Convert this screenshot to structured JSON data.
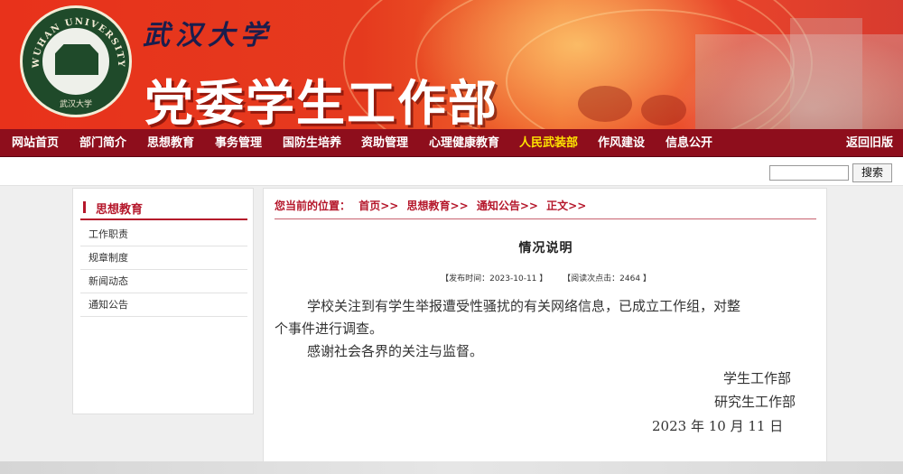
{
  "header": {
    "calligraphy": "武汉大学",
    "title": "党委学生工作部",
    "logo_ring_text": "WUHAN UNIVERSITY",
    "logo_sub_text": "武汉大学"
  },
  "nav": {
    "items": [
      {
        "label": "网站首页"
      },
      {
        "label": "部门简介"
      },
      {
        "label": "思想教育"
      },
      {
        "label": "事务管理"
      },
      {
        "label": "国防生培养"
      },
      {
        "label": "资助管理"
      },
      {
        "label": "心理健康教育"
      },
      {
        "label": "人民武装部",
        "active": true
      },
      {
        "label": "作风建设"
      },
      {
        "label": "信息公开"
      }
    ],
    "back_label": "返回旧版"
  },
  "search": {
    "value": "",
    "button_label": "搜索"
  },
  "sidebar": {
    "heading": "思想教育",
    "items": [
      {
        "label": "工作职责"
      },
      {
        "label": "规章制度"
      },
      {
        "label": "新闻动态"
      },
      {
        "label": "通知公告"
      }
    ]
  },
  "breadcrumb": {
    "prefix": "您当前的位置：",
    "items": [
      "首页>>",
      "思想教育>>",
      "通知公告>>",
      "正文>>"
    ]
  },
  "article": {
    "title": "情况说明",
    "publish_label": "【发布时间：2023-10-11 】",
    "views_label": "【阅读次点击：2464 】",
    "para1_line1": "学校关注到有学生举报遭受性骚扰的有关网络信息，已成立工作组，对整",
    "para1_line2": "个事件进行调查。",
    "para2": "感谢社会各界的关注与监督。",
    "signature1": "学生工作部",
    "signature2": "研究生工作部",
    "date": "2023 年 10 月 11 日"
  },
  "colors": {
    "nav_bg": "#8e0e1c",
    "accent": "#b5172b",
    "active_nav": "#ffe400"
  }
}
